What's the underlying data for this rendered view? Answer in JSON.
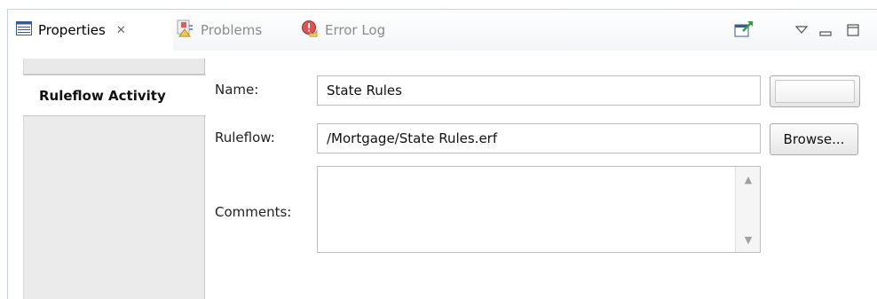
{
  "tabs": {
    "properties_label": "Properties",
    "problems_label": "Problems",
    "errorlog_label": "Error Log"
  },
  "toolbar_icons": [
    "pin-to-selection-icon",
    "view-menu-icon",
    "minimize-icon",
    "maximize-icon"
  ],
  "section_tabs": [
    {
      "label": "Ruleflow Activity",
      "selected": true
    }
  ],
  "form": {
    "name_label": "Name:",
    "name_value": "State Rules",
    "ruleflow_label": "Ruleflow:",
    "ruleflow_value": "/Mortgage/State Rules.erf",
    "comments_label": "Comments:",
    "comments_value": "",
    "browse_label": "Browse..."
  },
  "colors": {
    "tab_border": "#c9d3e6",
    "disabled_text": "#8c8c8c",
    "left_panel_bg": "#ebebeb"
  }
}
